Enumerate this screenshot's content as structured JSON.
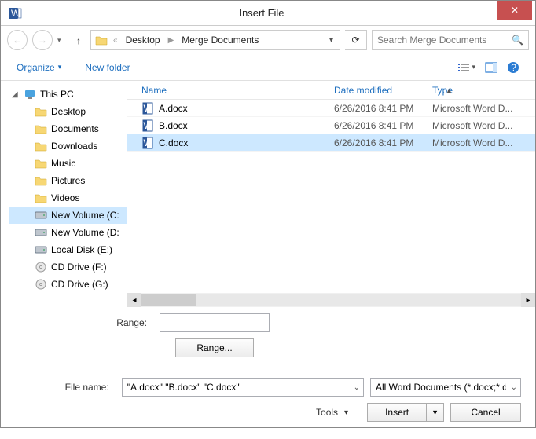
{
  "window": {
    "title": "Insert File",
    "close_glyph": "✕"
  },
  "nav": {
    "back_glyph": "←",
    "fwd_glyph": "→",
    "dd_glyph": "▾",
    "up_glyph": "↑",
    "crumb_prefix": "«",
    "crumbs": [
      "Desktop",
      "Merge Documents"
    ],
    "refresh_glyph": "⟳",
    "search_placeholder": "Search Merge Documents",
    "search_icon": "🔍"
  },
  "toolbar": {
    "organize_label": "Organize",
    "newfolder_label": "New folder",
    "view_dd": "▾",
    "help_glyph": "?"
  },
  "sidebar": {
    "items": [
      {
        "label": "This PC",
        "icon": "pc",
        "level": 0,
        "expanded": true
      },
      {
        "label": "Desktop",
        "icon": "folder",
        "level": 1
      },
      {
        "label": "Documents",
        "icon": "folder",
        "level": 1
      },
      {
        "label": "Downloads",
        "icon": "folder",
        "level": 1
      },
      {
        "label": "Music",
        "icon": "folder",
        "level": 1
      },
      {
        "label": "Pictures",
        "icon": "folder",
        "level": 1
      },
      {
        "label": "Videos",
        "icon": "folder",
        "level": 1
      },
      {
        "label": "New Volume (C:)",
        "icon": "drive",
        "level": 1,
        "selected": true,
        "truncLabel": "New Volume (C:"
      },
      {
        "label": "New Volume (D:)",
        "icon": "drive",
        "level": 1,
        "truncLabel": "New Volume (D:"
      },
      {
        "label": "Local Disk (E:)",
        "icon": "drive",
        "level": 1
      },
      {
        "label": "CD Drive (F:)",
        "icon": "cd",
        "level": 1
      },
      {
        "label": "CD Drive (G:)",
        "icon": "cd",
        "level": 1
      }
    ]
  },
  "columns": {
    "name": "Name",
    "date": "Date modified",
    "type": "Type",
    "sort_glyph": "▲"
  },
  "files": [
    {
      "name": "A.docx",
      "date": "6/26/2016 8:41 PM",
      "type": "Microsoft Word D...",
      "selected": false
    },
    {
      "name": "B.docx",
      "date": "6/26/2016 8:41 PM",
      "type": "Microsoft Word D...",
      "selected": false
    },
    {
      "name": "C.docx",
      "date": "6/26/2016 8:41 PM",
      "type": "Microsoft Word D...",
      "selected": true
    }
  ],
  "range": {
    "label": "Range:",
    "button": "Range..."
  },
  "filename": {
    "label": "File name:",
    "value": "\"A.docx\" \"B.docx\" \"C.docx\""
  },
  "filetype": {
    "value": "All Word Documents (*.docx;*.d"
  },
  "actions": {
    "tools": "Tools",
    "insert": "Insert",
    "cancel": "Cancel",
    "dd": "▾"
  }
}
